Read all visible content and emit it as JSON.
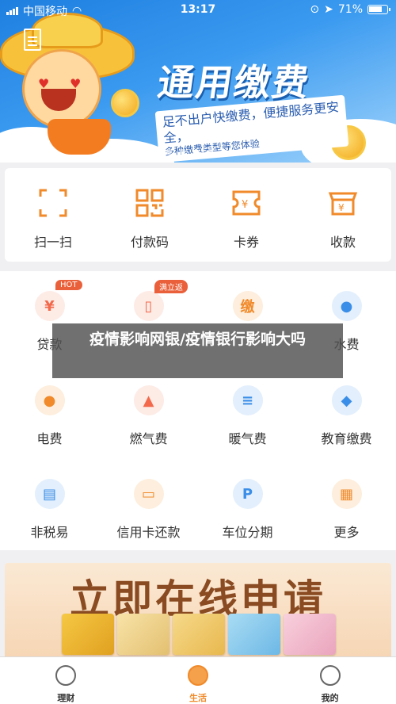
{
  "status_bar": {
    "carrier": "中国移动",
    "time": "13:17",
    "battery": "71%"
  },
  "banner": {
    "title": "通用缴费",
    "subtitle_line1": "足不出户快缴费，便捷服务更安全，",
    "subtitle_line2": "多种缴费类型等您体验",
    "page_count": 4,
    "active_page": 3
  },
  "quick_actions": [
    {
      "label": "扫一扫",
      "icon": "scan-icon"
    },
    {
      "label": "付款码",
      "icon": "qrcode-icon"
    },
    {
      "label": "卡券",
      "icon": "coupon-icon"
    },
    {
      "label": "收款",
      "icon": "shop-icon"
    }
  ],
  "services": [
    {
      "name": "贷款",
      "icon": "loan-icon",
      "badge": "HOT",
      "color": "#f26a4b",
      "bg": "#fdebe6"
    },
    {
      "name": "",
      "icon": "phone-recharge-icon",
      "badge": "满立返",
      "color": "#f26a4b",
      "bg": "#fdebe6"
    },
    {
      "name": "",
      "icon": "tax-coin-icon",
      "badge": "",
      "color": "#f08a2a",
      "bg": "#fdeedd",
      "glyph": "缴"
    },
    {
      "name": "水费",
      "icon": "water-drop-icon",
      "badge": "",
      "color": "#3a8ee8",
      "bg": "#e3effc"
    },
    {
      "name": "电费",
      "icon": "bulb-icon",
      "badge": "",
      "color": "#f08a2a",
      "bg": "#fdeedd"
    },
    {
      "name": "燃气费",
      "icon": "flame-icon",
      "badge": "",
      "color": "#f26a4b",
      "bg": "#fdebe6"
    },
    {
      "name": "暖气费",
      "icon": "heater-icon",
      "badge": "",
      "color": "#3a8ee8",
      "bg": "#e3effc"
    },
    {
      "name": "教育缴费",
      "icon": "graduation-cap-icon",
      "badge": "",
      "color": "#3a8ee8",
      "bg": "#e3effc"
    },
    {
      "name": "非税易",
      "icon": "tax-doc-icon",
      "badge": "",
      "color": "#3a8ee8",
      "bg": "#e3effc"
    },
    {
      "name": "信用卡还款",
      "icon": "credit-card-icon",
      "badge": "",
      "color": "#f08a2a",
      "bg": "#fdeedd"
    },
    {
      "name": "车位分期",
      "icon": "parking-icon",
      "badge": "",
      "color": "#3a8ee8",
      "bg": "#e3effc"
    },
    {
      "name": "更多",
      "icon": "grid-more-icon",
      "badge": "",
      "color": "#f08a2a",
      "bg": "#fdeedd"
    }
  ],
  "overlay_caption": "疫情影响网银/疫情银行影响大吗",
  "promo": {
    "title": "立即在线申请"
  },
  "tabs": [
    {
      "label": "理财",
      "icon": "money-bag-icon",
      "active": false
    },
    {
      "label": "生活",
      "icon": "life-coin-icon",
      "active": true
    },
    {
      "label": "我的",
      "icon": "user-icon",
      "active": false
    }
  ],
  "colors": {
    "accent": "#f08a2a",
    "banner_blue": "#1f7fe0"
  }
}
